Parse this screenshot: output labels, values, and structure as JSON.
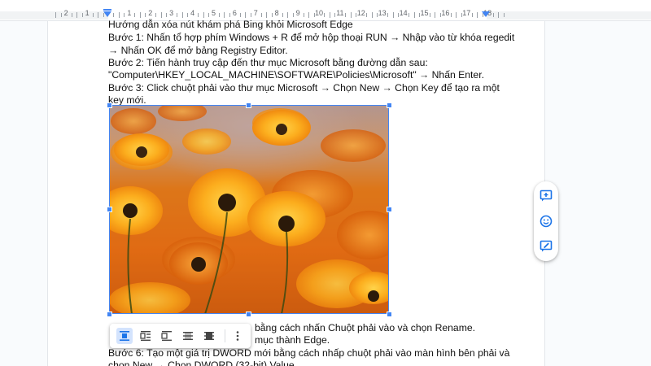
{
  "ruler": {
    "numbers": [
      "2",
      "1",
      "1",
      "2",
      "3",
      "4",
      "5",
      "6",
      "7",
      "8",
      "9",
      "10",
      "11",
      "12",
      "13",
      "14",
      "15",
      "16",
      "17",
      "18"
    ]
  },
  "document": {
    "lines": [
      "Hướng dẫn xóa nút khám phá Bing khỏi Microsoft Edge",
      "Bước 1: Nhấn tổ hợp phím Windows + R để mở hộp thoại RUN → Nhập vào từ khóa regedit",
      "→ Nhấn OK để mở bảng Registry Editor.",
      "Bước 2: Tiến hành truy cập đến thư mục Microsoft bằng đường dẫn sau:",
      "\"Computer\\HKEY_LOCAL_MACHINE\\SOFTWARE\\Policies\\Microsoft\" → Nhấn Enter.",
      "Bước 3: Click chuột phải vào thư mục Microsoft → Chọn New → Chọn Key để tạo ra một",
      "key mới."
    ],
    "lines_after_image": [
      "bằng cách nhấn Chuột phải vào và chọn Rename.",
      "mục thành Edge.",
      "Bước 6: Tạo một giá trị DWORD mới bằng cách nhấp chuột phải vào màn hình bên phải và",
      "chọn New → Chọn DWORD (32-bit) Value."
    ]
  },
  "image": {
    "description_icon": "orange-flowers-photo",
    "accent": "#e8791a"
  },
  "side_toolbar": {
    "items": [
      {
        "icon": "add-comment-icon"
      },
      {
        "icon": "emoji-reaction-icon"
      },
      {
        "icon": "suggest-edit-icon"
      }
    ]
  },
  "wrap_toolbar": {
    "items": [
      {
        "icon": "inline-icon",
        "active": true
      },
      {
        "icon": "wrap-text-icon",
        "active": false
      },
      {
        "icon": "break-text-icon",
        "active": false
      },
      {
        "icon": "behind-text-icon",
        "active": false
      },
      {
        "icon": "in-front-of-text-icon",
        "active": false
      },
      {
        "icon": "more-options-icon",
        "active": false
      }
    ]
  },
  "colors": {
    "accent": "#4285f4",
    "toolbar_icon": "#1a73e8"
  }
}
